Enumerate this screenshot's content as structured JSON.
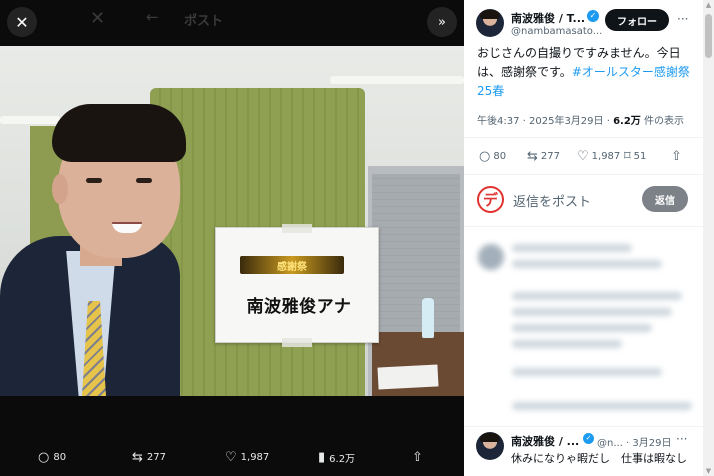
{
  "viewer": {
    "background_title": "ポスト",
    "close_icon": "close-icon",
    "expand_icon": "chevrons-right-icon",
    "sign_text": "南波雅俊アナ",
    "sign_logo_text": "感謝祭",
    "actions": [
      {
        "icon": "reply-icon",
        "glyph": "💬",
        "count": "80"
      },
      {
        "icon": "repost-icon",
        "glyph": "⇆",
        "count": "277"
      },
      {
        "icon": "like-icon",
        "glyph": "♡",
        "count": "1,987"
      },
      {
        "icon": "views-icon",
        "glyph": "▮",
        "count": "6.2万"
      },
      {
        "icon": "share-icon",
        "glyph": "⇧",
        "count": ""
      }
    ]
  },
  "post": {
    "author_name": "南波雅俊 / T...",
    "handle": "@nambamasato...",
    "follow_label": "フォロー",
    "more_label": "···",
    "text_main": "おじさんの自撮りですみません。今日は、感謝祭です。",
    "hashtag": "#オールスター感謝祭25春",
    "meta_time": "午後4:37 · 2025年3月29日 · ",
    "meta_views": "6.2万",
    "meta_views_suffix": " 件の表示",
    "actions": {
      "reply": "80",
      "repost": "277",
      "like": "1,987",
      "bookmark": "51"
    }
  },
  "reply_box": {
    "logo": "デ",
    "placeholder": "返信をポスト",
    "button": "返信"
  },
  "reply": {
    "author_name": "南波雅俊 / ...",
    "handle": "@n... · 3月29日",
    "more_label": "···",
    "text": "休みになりゃ暇だし　仕事は暇なし"
  }
}
